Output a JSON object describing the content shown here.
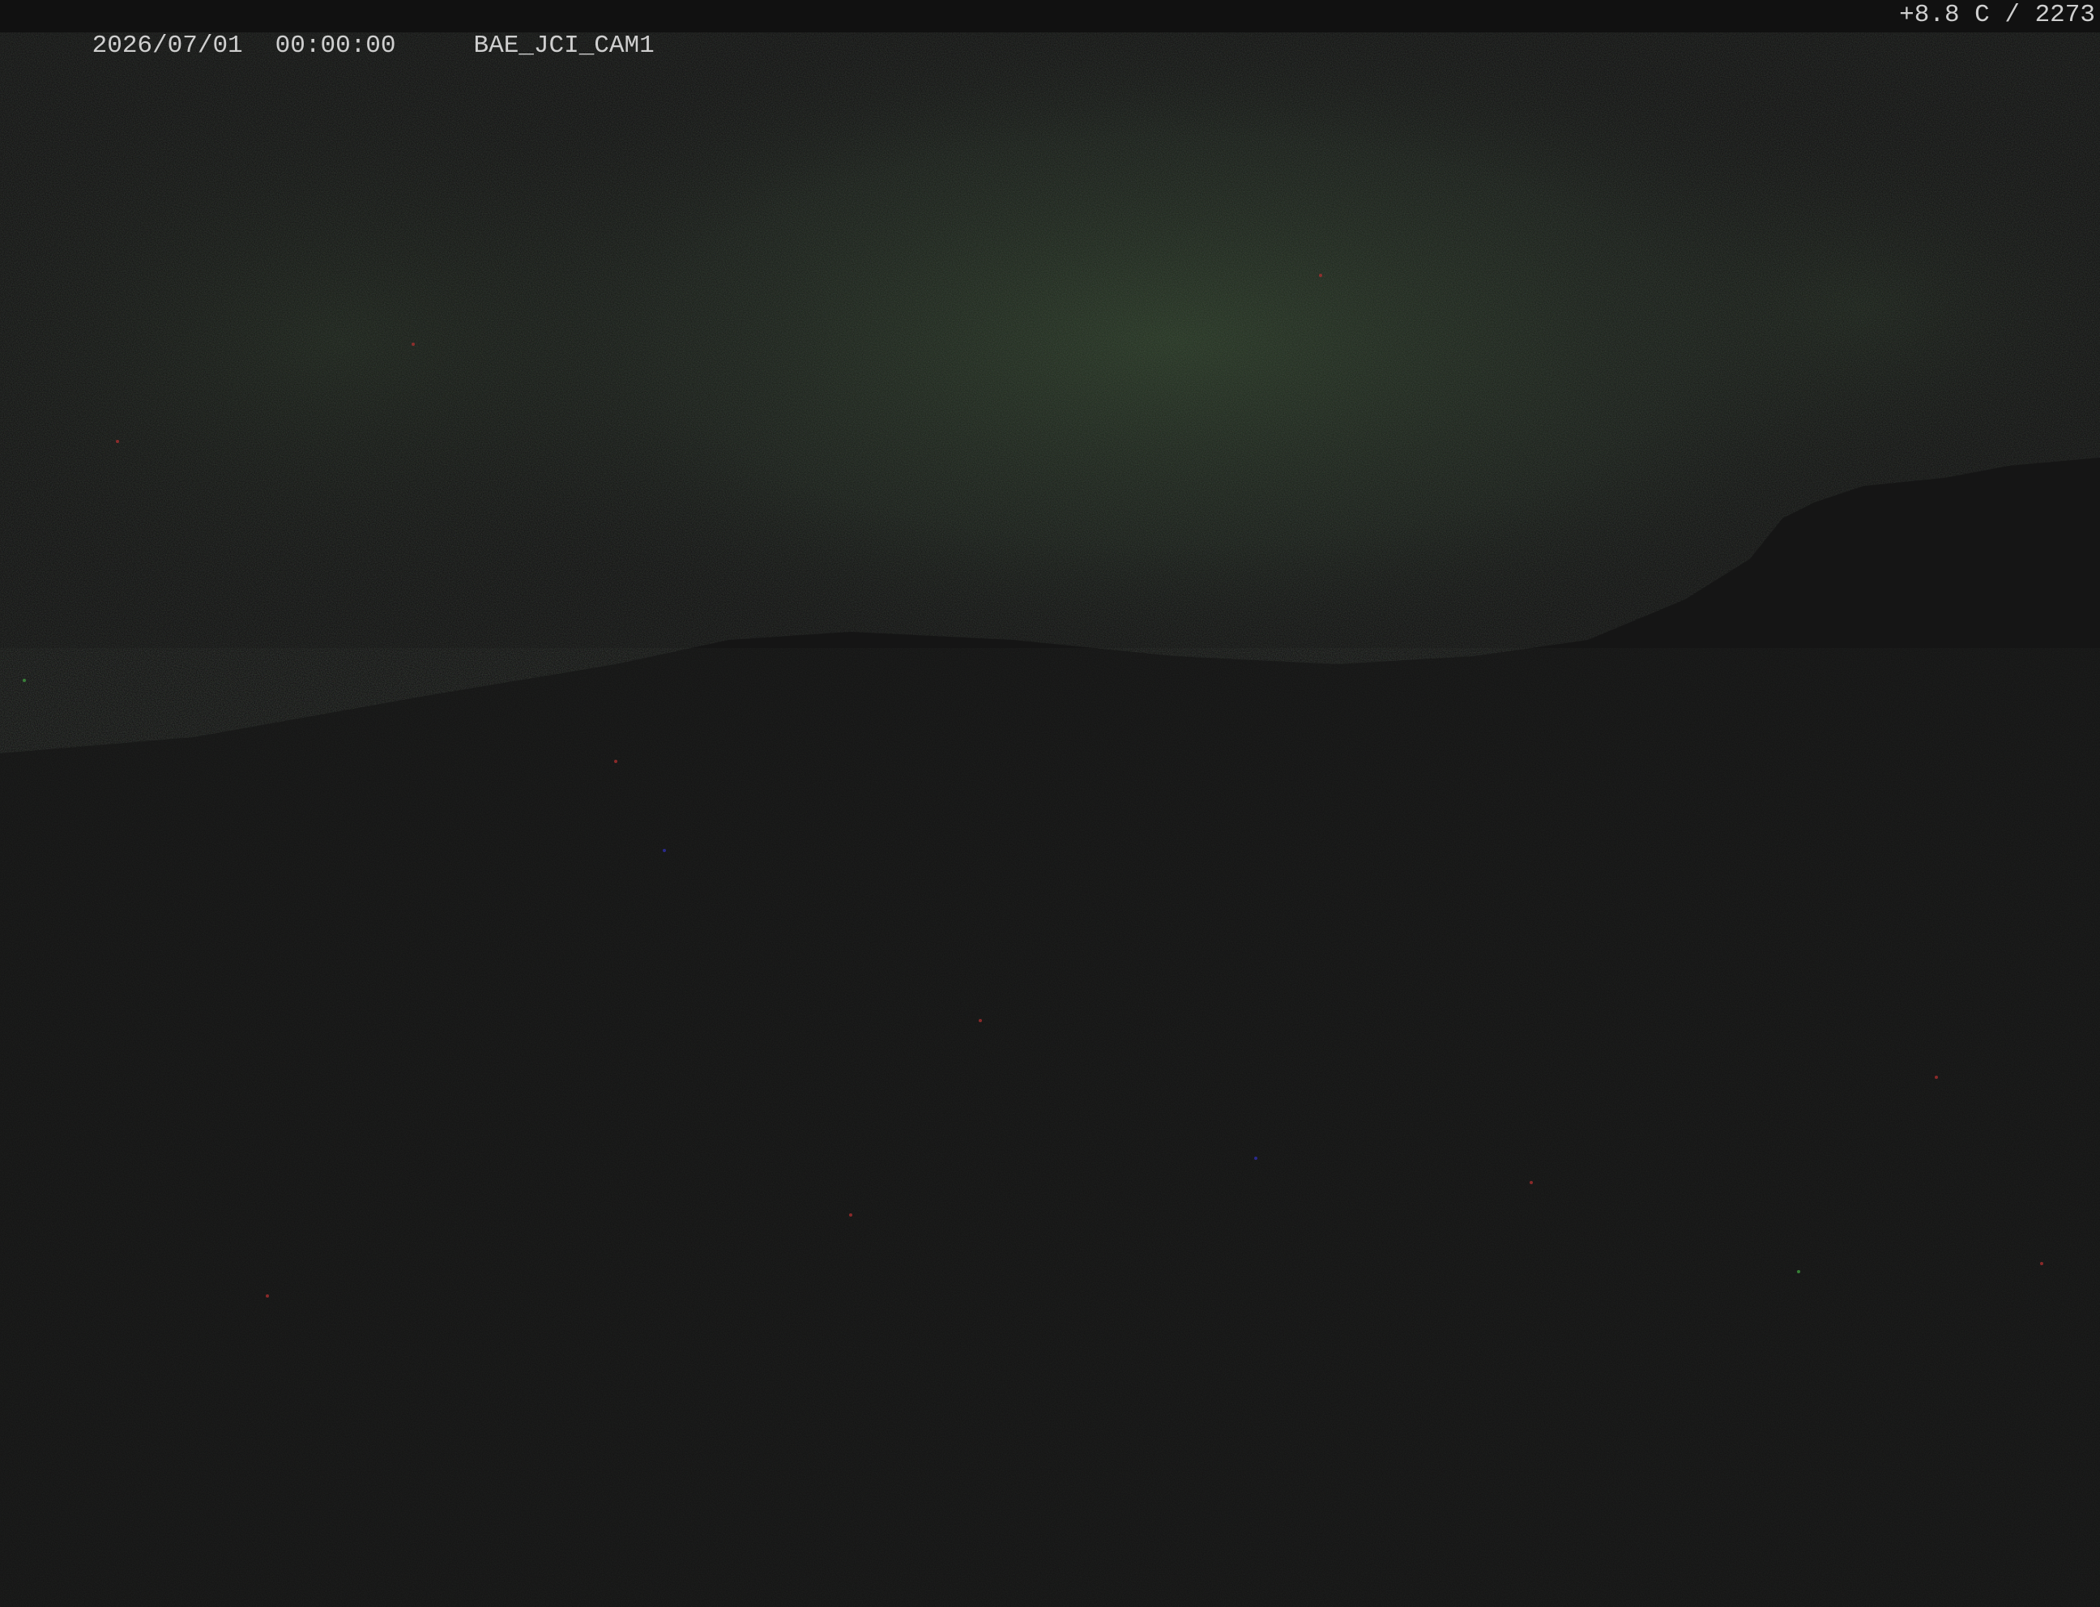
{
  "overlay": {
    "date": "2026/07/01",
    "time": "00:00:00",
    "camera_id": "BAE_JCI_CAM1",
    "sensor_readout": "+8.8 C / 2273"
  },
  "scene": {
    "description_type": "night webcam frame",
    "colors": {
      "background": "#151515",
      "sky_glow": "#223022",
      "overlay_bar": "#111111",
      "overlay_text": "#cfcfcf"
    }
  }
}
